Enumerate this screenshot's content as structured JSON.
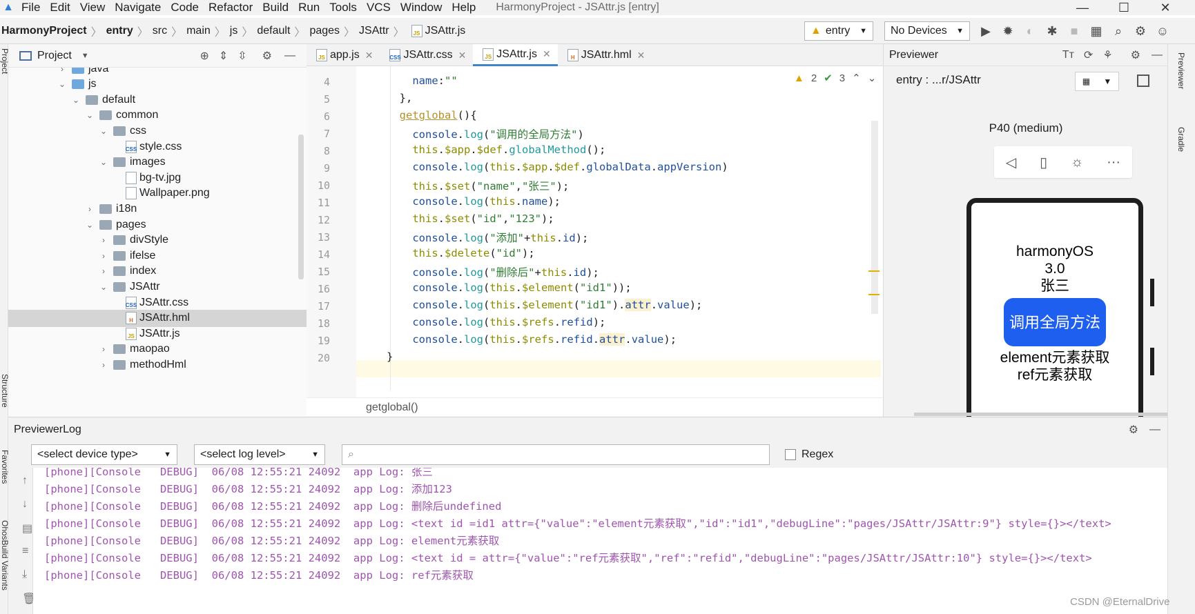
{
  "menu": {
    "items": [
      "File",
      "Edit",
      "View",
      "Navigate",
      "Code",
      "Refactor",
      "Build",
      "Run",
      "Tools",
      "VCS",
      "Window",
      "Help"
    ],
    "window_title": "HarmonyProject - JSAttr.js [entry]"
  },
  "window_controls": {
    "minimize": "—",
    "maximize": "☐",
    "close": "✕"
  },
  "breadcrumb": [
    "HarmonyProject",
    "entry",
    "src",
    "main",
    "js",
    "default",
    "pages",
    "JSAttr",
    "JSAttr.js"
  ],
  "toolbar": {
    "module_select": "entry",
    "device_select": "No Devices",
    "icons": [
      "run-icon",
      "debug-icon",
      "attach-icon",
      "profile-icon",
      "stop-icon",
      "project-structure-icon",
      "search-icon",
      "settings-icon",
      "account-icon"
    ]
  },
  "left_strip": {
    "project_label": "Project",
    "structure_label": "Structure",
    "favorites_label": "Favorites",
    "ohos_label": "OhosBuild Variants"
  },
  "project_panel": {
    "title": "Project",
    "tree": [
      {
        "label": "java",
        "kind": "folder-blue",
        "level": 1,
        "state": "collapsed"
      },
      {
        "label": "js",
        "kind": "folder-blue",
        "level": 1,
        "state": "expanded"
      },
      {
        "label": "default",
        "kind": "folder",
        "level": 2,
        "state": "expanded"
      },
      {
        "label": "common",
        "kind": "folder",
        "level": 3,
        "state": "expanded"
      },
      {
        "label": "css",
        "kind": "folder",
        "level": 4,
        "state": "expanded"
      },
      {
        "label": "style.css",
        "kind": "css",
        "level": 5,
        "state": ""
      },
      {
        "label": "images",
        "kind": "folder",
        "level": 4,
        "state": "expanded"
      },
      {
        "label": "bg-tv.jpg",
        "kind": "img",
        "level": 5,
        "state": ""
      },
      {
        "label": "Wallpaper.png",
        "kind": "img",
        "level": 5,
        "state": ""
      },
      {
        "label": "i18n",
        "kind": "folder",
        "level": 3,
        "state": "collapsed"
      },
      {
        "label": "pages",
        "kind": "folder",
        "level": 3,
        "state": "expanded"
      },
      {
        "label": "divStyle",
        "kind": "folder",
        "level": 4,
        "state": "collapsed"
      },
      {
        "label": "ifelse",
        "kind": "folder",
        "level": 4,
        "state": "collapsed"
      },
      {
        "label": "index",
        "kind": "folder",
        "level": 4,
        "state": "collapsed"
      },
      {
        "label": "JSAttr",
        "kind": "folder",
        "level": 4,
        "state": "expanded"
      },
      {
        "label": "JSAttr.css",
        "kind": "css",
        "level": 5,
        "state": ""
      },
      {
        "label": "JSAttr.hml",
        "kind": "html",
        "level": 5,
        "state": "",
        "selected": true
      },
      {
        "label": "JSAttr.js",
        "kind": "js",
        "level": 5,
        "state": ""
      },
      {
        "label": "maopao",
        "kind": "folder",
        "level": 4,
        "state": "collapsed"
      },
      {
        "label": "methodHml",
        "kind": "folder",
        "level": 4,
        "state": "collapsed"
      }
    ]
  },
  "editor_tabs": [
    {
      "label": "app.js",
      "icon": "JS",
      "kind": "js",
      "active": false
    },
    {
      "label": "JSAttr.css",
      "icon": "CSS",
      "kind": "css",
      "active": false
    },
    {
      "label": "JSAttr.js",
      "icon": "JS",
      "kind": "js",
      "active": true
    },
    {
      "label": "JSAttr.hml",
      "icon": "H",
      "kind": "html",
      "active": false
    }
  ],
  "inspection": {
    "warnings": "2",
    "checks": "3"
  },
  "code_lines": [
    {
      "n": "4",
      "tokens": [
        [
          "    ",
          "p"
        ],
        [
          "name",
          "prop"
        ],
        [
          ":",
          "p"
        ],
        [
          "\"\"",
          "str"
        ]
      ]
    },
    {
      "n": "5",
      "tokens": [
        [
          "  },",
          "p"
        ]
      ]
    },
    {
      "n": "6",
      "tokens": [
        [
          "  ",
          "p"
        ],
        [
          "getglobal",
          "fn"
        ],
        [
          "(){",
          "p"
        ]
      ]
    },
    {
      "n": "7",
      "tokens": [
        [
          "    ",
          "p"
        ],
        [
          "console",
          "obj"
        ],
        [
          ".",
          "p"
        ],
        [
          "log",
          "call"
        ],
        [
          "(",
          "p"
        ],
        [
          "\"调用的全局方法\"",
          "str"
        ],
        [
          ")",
          "p"
        ]
      ]
    },
    {
      "n": "8",
      "tokens": [
        [
          "    ",
          "p"
        ],
        [
          "this",
          "kw"
        ],
        [
          ".",
          "p"
        ],
        [
          "$app",
          "kw"
        ],
        [
          ".",
          "p"
        ],
        [
          "$def",
          "kw"
        ],
        [
          ".",
          "p"
        ],
        [
          "globalMethod",
          "call"
        ],
        [
          "();",
          "p"
        ]
      ]
    },
    {
      "n": "9",
      "tokens": [
        [
          "    ",
          "p"
        ],
        [
          "console",
          "obj"
        ],
        [
          ".",
          "p"
        ],
        [
          "log",
          "call"
        ],
        [
          "(",
          "p"
        ],
        [
          "this",
          "kw"
        ],
        [
          ".",
          "p"
        ],
        [
          "$app",
          "kw"
        ],
        [
          ".",
          "p"
        ],
        [
          "$def",
          "kw"
        ],
        [
          ".",
          "p"
        ],
        [
          "globalData",
          "obj"
        ],
        [
          ".",
          "p"
        ],
        [
          "appVersion",
          "obj"
        ],
        [
          ")",
          "p"
        ]
      ]
    },
    {
      "n": "10",
      "tokens": [
        [
          "    ",
          "p"
        ],
        [
          "this",
          "kw"
        ],
        [
          ".",
          "p"
        ],
        [
          "$set",
          "kw"
        ],
        [
          "(",
          "p"
        ],
        [
          "\"name\"",
          "str"
        ],
        [
          ",",
          "p"
        ],
        [
          "\"张三\"",
          "str"
        ],
        [
          ");",
          "p"
        ]
      ]
    },
    {
      "n": "11",
      "tokens": [
        [
          "    ",
          "p"
        ],
        [
          "console",
          "obj"
        ],
        [
          ".",
          "p"
        ],
        [
          "log",
          "call"
        ],
        [
          "(",
          "p"
        ],
        [
          "this",
          "kw"
        ],
        [
          ".",
          "p"
        ],
        [
          "name",
          "obj"
        ],
        [
          ");",
          "p"
        ]
      ]
    },
    {
      "n": "12",
      "tokens": [
        [
          "    ",
          "p"
        ],
        [
          "this",
          "kw"
        ],
        [
          ".",
          "p"
        ],
        [
          "$set",
          "kw"
        ],
        [
          "(",
          "p"
        ],
        [
          "\"id\"",
          "str"
        ],
        [
          ",",
          "p"
        ],
        [
          "\"123\"",
          "str"
        ],
        [
          ");",
          "p"
        ]
      ]
    },
    {
      "n": "13",
      "tokens": [
        [
          "    ",
          "p"
        ],
        [
          "console",
          "obj"
        ],
        [
          ".",
          "p"
        ],
        [
          "log",
          "call"
        ],
        [
          "(",
          "p"
        ],
        [
          "\"添加\"",
          "str"
        ],
        [
          "+",
          "p"
        ],
        [
          "this",
          "kw"
        ],
        [
          ".",
          "p"
        ],
        [
          "id",
          "obj"
        ],
        [
          ");",
          "p"
        ]
      ]
    },
    {
      "n": "14",
      "tokens": [
        [
          "    ",
          "p"
        ],
        [
          "this",
          "kw"
        ],
        [
          ".",
          "p"
        ],
        [
          "$delete",
          "kw"
        ],
        [
          "(",
          "p"
        ],
        [
          "\"id\"",
          "str"
        ],
        [
          ");",
          "p"
        ]
      ]
    },
    {
      "n": "15",
      "tokens": [
        [
          "    ",
          "p"
        ],
        [
          "console",
          "obj"
        ],
        [
          ".",
          "p"
        ],
        [
          "log",
          "call"
        ],
        [
          "(",
          "p"
        ],
        [
          "\"删除后\"",
          "str"
        ],
        [
          "+",
          "p"
        ],
        [
          "this",
          "kw"
        ],
        [
          ".",
          "p"
        ],
        [
          "id",
          "obj"
        ],
        [
          ");",
          "p"
        ]
      ]
    },
    {
      "n": "16",
      "tokens": [
        [
          "    ",
          "p"
        ],
        [
          "console",
          "obj"
        ],
        [
          ".",
          "p"
        ],
        [
          "log",
          "call"
        ],
        [
          "(",
          "p"
        ],
        [
          "this",
          "kw"
        ],
        [
          ".",
          "p"
        ],
        [
          "$element",
          "kw"
        ],
        [
          "(",
          "p"
        ],
        [
          "\"id1\"",
          "str"
        ],
        [
          "));",
          "p"
        ]
      ]
    },
    {
      "n": "17",
      "tokens": [
        [
          "    ",
          "p"
        ],
        [
          "console",
          "obj"
        ],
        [
          ".",
          "p"
        ],
        [
          "log",
          "call"
        ],
        [
          "(",
          "p"
        ],
        [
          "this",
          "kw"
        ],
        [
          ".",
          "p"
        ],
        [
          "$element",
          "kw"
        ],
        [
          "(",
          "p"
        ],
        [
          "\"id1\"",
          "str"
        ],
        [
          ").",
          "p"
        ],
        [
          "attr",
          "hl"
        ],
        [
          ".",
          "p"
        ],
        [
          "value",
          "obj"
        ],
        [
          ");",
          "p"
        ]
      ]
    },
    {
      "n": "18",
      "tokens": [
        [
          "    ",
          "p"
        ],
        [
          "console",
          "obj"
        ],
        [
          ".",
          "p"
        ],
        [
          "log",
          "call"
        ],
        [
          "(",
          "p"
        ],
        [
          "this",
          "kw"
        ],
        [
          ".",
          "p"
        ],
        [
          "$refs",
          "kw"
        ],
        [
          ".",
          "p"
        ],
        [
          "refid",
          "obj"
        ],
        [
          ");",
          "p"
        ]
      ]
    },
    {
      "n": "19",
      "tokens": [
        [
          "    ",
          "p"
        ],
        [
          "console",
          "obj"
        ],
        [
          ".",
          "p"
        ],
        [
          "log",
          "call"
        ],
        [
          "(",
          "p"
        ],
        [
          "this",
          "kw"
        ],
        [
          ".",
          "p"
        ],
        [
          "$refs",
          "kw"
        ],
        [
          ".",
          "p"
        ],
        [
          "refid",
          "obj"
        ],
        [
          ".",
          "p"
        ],
        [
          "attr",
          "hl"
        ],
        [
          ".",
          "p"
        ],
        [
          "value",
          "obj"
        ],
        [
          ");",
          "p"
        ]
      ]
    },
    {
      "n": "20",
      "tokens": [
        [
          "}",
          "p"
        ]
      ]
    }
  ],
  "code_breadcrumb": "getglobal()",
  "previewer": {
    "title": "Previewer",
    "path": "entry : ...r/JSAttr",
    "device": "P40 (medium)",
    "screen": {
      "line1": "harmonyOS",
      "line2": "3.0",
      "line3": "张三",
      "button": "调用全局方法",
      "line4": "element元素获取",
      "line5": "ref元素获取"
    }
  },
  "right_strip": {
    "previewer_label": "Previewer",
    "gradle_label": "Gradle"
  },
  "log": {
    "title": "PreviewerLog",
    "device_type_select": "<select device type>",
    "log_level_select": "<select log level>",
    "search_placeholder": "",
    "regex_label": "Regex",
    "lines": [
      "[phone][Console   DEBUG]  06/08 12:55:21 24092  app Log: 张三",
      "[phone][Console   DEBUG]  06/08 12:55:21 24092  app Log: 添加123",
      "[phone][Console   DEBUG]  06/08 12:55:21 24092  app Log: 删除后undefined",
      "[phone][Console   DEBUG]  06/08 12:55:21 24092  app Log: <text id =id1 attr={\"value\":\"element元素获取\",\"id\":\"id1\",\"debugLine\":\"pages/JSAttr/JSAttr:9\"} style={}></text>",
      "[phone][Console   DEBUG]  06/08 12:55:21 24092  app Log: element元素获取",
      "[phone][Console   DEBUG]  06/08 12:55:21 24092  app Log: <text id = attr={\"value\":\"ref元素获取\",\"ref\":\"refid\",\"debugLine\":\"pages/JSAttr/JSAttr:10\"} style={}></text>",
      "[phone][Console   DEBUG]  06/08 12:55:21 24092  app Log: ref元素获取"
    ]
  },
  "watermark": "CSDN @EternalDrive",
  "colors": {
    "keyword": "#8c8c00",
    "string": "#2e7d32",
    "function": "#b5902b",
    "object": "#1f4e9a",
    "call": "#20999d",
    "log_text": "#a054b0",
    "accent": "#4083c9",
    "device_button": "#1f5ff0"
  }
}
